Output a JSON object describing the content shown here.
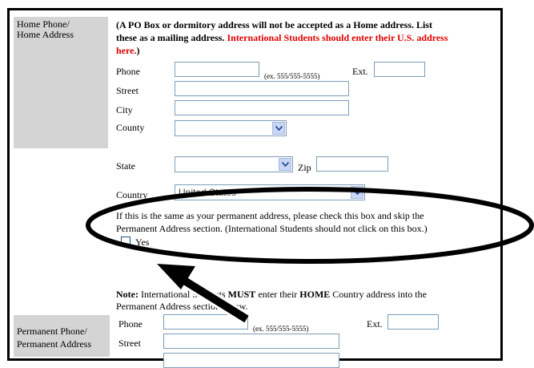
{
  "home": {
    "label": [
      "Home Phone/",
      "Home Address"
    ],
    "notice": {
      "line1": "(A PO Box or dormitory address will not be accepted as a Home address. List",
      "line2_black": "these as a mailing address.",
      "line2_red": " International Students should enter their U.S. address",
      "line3_red": "here.",
      "line3_black": ")"
    },
    "phone_label": "Phone",
    "phone_example": "(ex. 555/555-5555)",
    "ext_label": "Ext.",
    "street_label": "Street",
    "city_label": "City",
    "county_label": "County",
    "state_label": "State",
    "zip_label": "Zip",
    "country_label": "Country",
    "country_value": "United States",
    "same_address_line1": "If this is the same as your permanent address, please check this box and skip the",
    "same_address_line2": "Permanent Address section. (International Students should not click on this box.)",
    "yes_label": "Yes"
  },
  "note": {
    "prefix": "Note:",
    "text1": " International Students ",
    "must": "MUST",
    "text2": " enter their ",
    "home": "HOME",
    "text3": " Country address into the",
    "line2": "Permanent Address section below."
  },
  "permanent": {
    "label": [
      "Permanent Phone/",
      "Permanent Address"
    ],
    "phone_label": "Phone",
    "phone_example": "(ex. 555/555-5555)",
    "ext_label": "Ext.",
    "street_label": "Street"
  },
  "colors": {
    "label_bg": "#d4d4d4",
    "red_text": "#e00000",
    "input_border": "#7f9db9",
    "annotation": "#000000"
  }
}
